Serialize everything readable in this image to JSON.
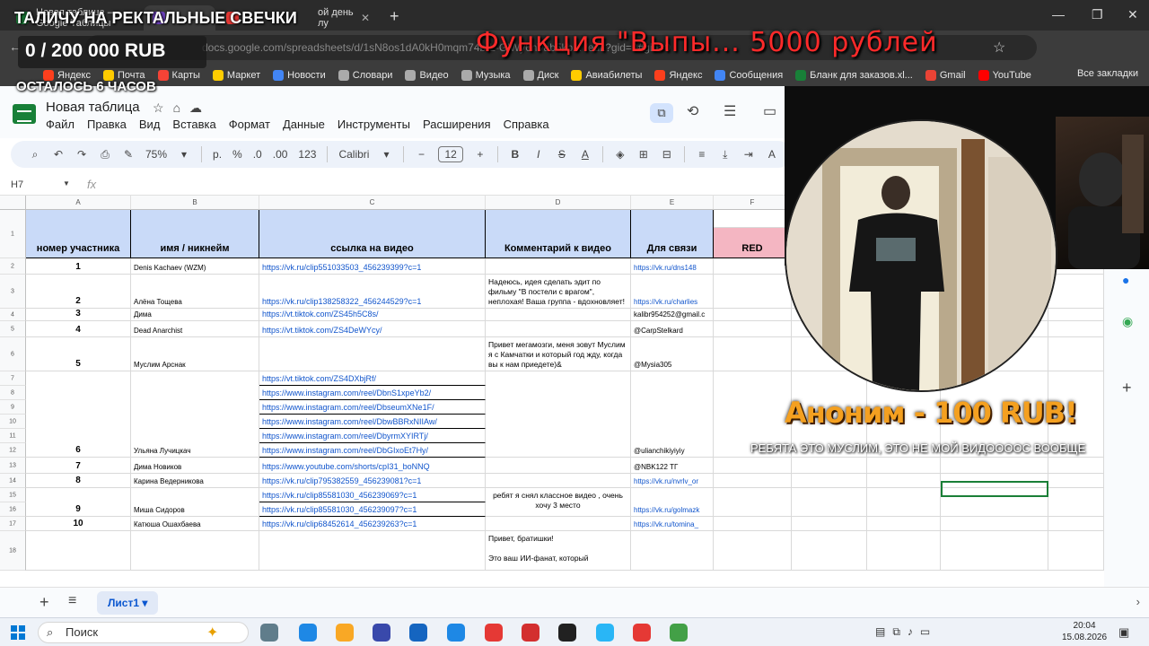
{
  "overlay": {
    "title": "ТАЛИЧУ НА РЕКТАЛЬНЫЕ СВЕЧКИ",
    "counter": "0 / 200 000 RUB",
    "time_left": "ОСТАЛОСЬ 6 ЧАСОВ",
    "red_title": "Функция \"Выпы... 5000 рублей",
    "donation_title": "Аноним - 100 RUB!",
    "donation_message": "РЕБЯТА ЭТО МУСЛИМ, ЭТО НЕ МОЙ ВИДООООС ВООБЩЕ"
  },
  "browser": {
    "tabs": [
      {
        "label": "Новая таблица – Google Таблицы",
        "color": "#188038"
      },
      {
        "label": "Приглашение — Ролик ...",
        "color": "#6f42c1"
      },
      {
        "label": "ой день лу",
        "color": "#e53935"
      }
    ],
    "address": "docs.google.com/spreadsheets/d/1sN8os1dA0kH0mqm74b-L-GlWy6nVab5kb... /edit?gid=0#gid=0",
    "bookmarks": [
      {
        "label": "Яндекс",
        "color": "#fc3f1d"
      },
      {
        "label": "Почта",
        "color": "#ffcc00"
      },
      {
        "label": "Карты",
        "color": "#f44336"
      },
      {
        "label": "Маркет",
        "color": "#ffcc00"
      },
      {
        "label": "Новости",
        "color": "#4285f4"
      },
      {
        "label": "Словари",
        "color": "#aaaaaa"
      },
      {
        "label": "Видео",
        "color": "#aaaaaa"
      },
      {
        "label": "Музыка",
        "color": "#aaaaaa"
      },
      {
        "label": "Диск",
        "color": "#aaaaaa"
      },
      {
        "label": "Авиабилеты",
        "color": "#ffcc00"
      },
      {
        "label": "Яндекс",
        "color": "#fc3f1d"
      },
      {
        "label": "Сообщения",
        "color": "#4285f4"
      },
      {
        "label": "Бланк для заказов.xl...",
        "color": "#188038"
      },
      {
        "label": "Gmail",
        "color": "#ea4335"
      },
      {
        "label": "YouTube",
        "color": "#ff0000"
      }
    ],
    "all_bookmarks": "Все закладки"
  },
  "sheets": {
    "title": "Новая таблица",
    "menu": [
      "Файл",
      "Правка",
      "Вид",
      "Вставка",
      "Формат",
      "Данные",
      "Инструменты",
      "Расширения",
      "Справка"
    ],
    "zoom": "75%",
    "currency": "р.",
    "percent": "%",
    "dec_minus": ".0",
    ".dec_plus": ".00",
    "dec_plus": ".00",
    "format123": "123",
    "font": "Calibri",
    "font_size": "12",
    "cell_ref": "H7",
    "fx": "fx",
    "columns": [
      "A",
      "B",
      "C",
      "D",
      "E",
      "F"
    ],
    "headers": {
      "a": "номер участника",
      "b": "имя / никнейм",
      "c": "ссылка на видео",
      "d": "Комментарий к видео",
      "e": "Для связи",
      "f": "RED"
    },
    "rows": [
      {
        "num": "1",
        "name": "Denis Kachaev (WZM)",
        "links": [
          "https://vk.ru/clip551033503_456239399?c=1"
        ],
        "comment": "",
        "contact": "https://vk.ru/dns148"
      },
      {
        "num": "2",
        "name": "Алёна Тощева",
        "links": [
          "https://vk.ru/clip138258322_456244529?c=1"
        ],
        "comment": "Надеюсь, идея сделать эдит по фильму \"В постели с врагом\", неплохая! Ваша группа - вдохновляет! ^_^",
        "contact": "https://vk.ru/charlies"
      },
      {
        "num": "3",
        "name": "Дима",
        "links": [
          "https://vt.tiktok.com/ZS45h5C8s/"
        ],
        "comment": "",
        "contact": "kalibr954252@gmail.c"
      },
      {
        "num": "4",
        "name": "Dead Anarchist",
        "links": [
          "https://vt.tiktok.com/ZS4DeWYcy/"
        ],
        "comment": "",
        "contact": "@CarpStelkard"
      },
      {
        "num": "5",
        "name": "Муслим Арснак",
        "links": [],
        "comment": "Привет мегамозги, меня зовут Муслим я с Камчатки и который год жду, когда вы к нам приедете)&",
        "contact": "@Mysia305"
      },
      {
        "num": "6",
        "name": "Ульяна Лучицкач",
        "links": [
          "https://vt.tiktok.com/ZS4DXbjRf/",
          "https://www.instagram.com/reel/DbnS1xpeYb2/",
          "https://www.instagram.com/reel/DbseumXNe1F/",
          "https://www.instagram.com/reel/DbwBBRxNIIAw/",
          "https://www.instagram.com/reel/DbyrmXYIRTj/",
          "https://www.instagram.com/reel/DbGIxoEt7Hy/"
        ],
        "comment": "",
        "contact": "@ulianchikiyiyiy"
      },
      {
        "num": "7",
        "name": "Дима Новиков",
        "links": [
          "https://www.youtube.com/shorts/cpI31_boNNQ"
        ],
        "comment": "",
        "contact": "@NBK122 ТГ"
      },
      {
        "num": "8",
        "name": "Карина Ведерникова",
        "links": [
          "https://vk.ru/clip795382559_456239081?c=1"
        ],
        "comment": "",
        "contact": "https://vk.ru/nvrlv_or"
      },
      {
        "num": "9",
        "name": "Миша Сидоров",
        "links": [
          "https://vk.ru/clip85581030_456239069?c=1",
          "https://vk.ru/clip85581030_456239097?c=1"
        ],
        "comment": "ребят я снял классное видео , очень хочу 3 место",
        "contact": "https://vk.ru/golmazk"
      },
      {
        "num": "10",
        "name": "Катюша Ошахбаева",
        "links": [
          "https://vk.ru/clip68452614_456239263?c=1"
        ],
        "comment": "",
        "contact": "https://vk.ru/tomina_"
      },
      {
        "num": "",
        "name": "",
        "links": [],
        "comment": "Привет, братишки!\n\nЭто ваш ИИ-фанат, который",
        "contact": ""
      }
    ],
    "sheet_tab": "Лист1"
  },
  "taskbar": {
    "search": "Поиск",
    "time": "20:04",
    "date": "15.08.2026",
    "apps": [
      {
        "name": "widgets",
        "color": "#607d8b"
      },
      {
        "name": "edge",
        "color": "#1e88e5"
      },
      {
        "name": "explorer",
        "color": "#f9a825"
      },
      {
        "name": "store",
        "color": "#3949ab"
      },
      {
        "name": "snipping",
        "color": "#1565c0"
      },
      {
        "name": "unknown-blue",
        "color": "#1e88e5"
      },
      {
        "name": "yandex-y",
        "color": "#e53935"
      },
      {
        "name": "yandex-browser",
        "color": "#d32f2f"
      },
      {
        "name": "obs",
        "color": "#212121"
      },
      {
        "name": "telegram",
        "color": "#29b6f6"
      },
      {
        "name": "yandex-y2",
        "color": "#e53935"
      },
      {
        "name": "chrome",
        "color": "#43a047"
      }
    ]
  }
}
